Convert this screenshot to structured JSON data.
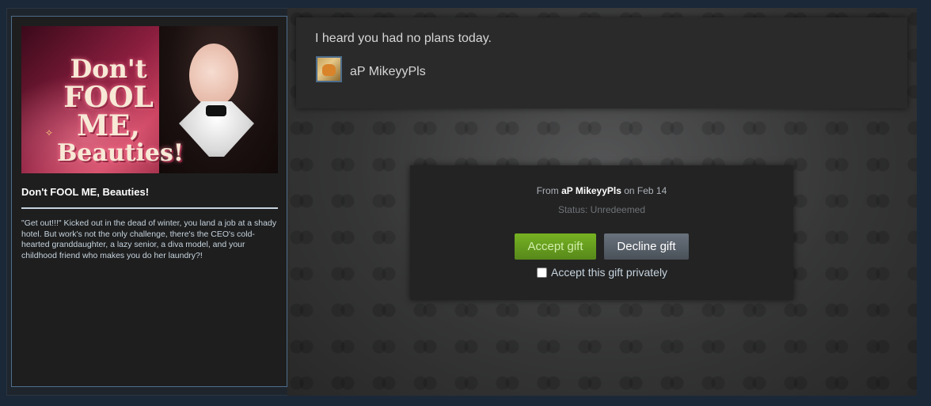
{
  "game": {
    "capsule_title_line1": "Don't",
    "capsule_title_line2": "FOOL ME,",
    "capsule_title_line3": "Beauties!",
    "title": "Don't FOOL ME, Beauties!",
    "description": "\"Get out!!!\" Kicked out in the dead of winter, you land a job at a shady hotel. But work's not the only challenge, there's the CEO's cold-hearted granddaughter, a lazy senior, a diva model, and your childhood friend who makes you do her laundry?!"
  },
  "message": {
    "text": "I heard you had no plans today.",
    "sender_name": "aP MikeyyPls"
  },
  "gift": {
    "from_prefix": "From ",
    "from_name": "aP MikeyyPls",
    "from_suffix": " on Feb 14",
    "status": "Status: Unredeemed",
    "accept_label": "Accept gift",
    "decline_label": "Decline gift",
    "private_label": "Accept this gift privately",
    "private_checked": false
  },
  "colors": {
    "accept_green": "#75b022",
    "decline_gray": "#67707b",
    "card_border": "#4e6d8c"
  }
}
